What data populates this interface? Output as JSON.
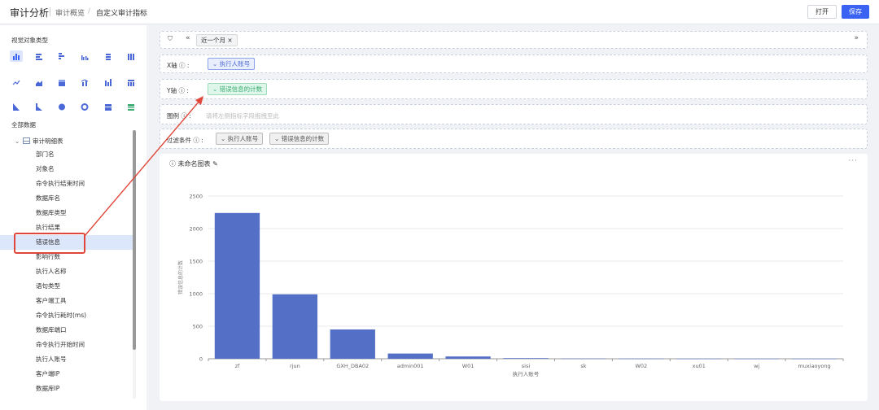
{
  "header": {
    "app_title": "审计分析",
    "breadcrumb": [
      "审计概览",
      "自定义审计指标"
    ],
    "open_label": "打开",
    "save_label": "保存"
  },
  "sidebar": {
    "visual_type_title": "视觉对象类型",
    "all_data_title": "全部数据",
    "table_name": "审计明细表",
    "fields": [
      "部门名",
      "对象名",
      "命令执行结束时间",
      "数据库名",
      "数据库类型",
      "执行结果",
      "错误信息",
      "影响行数",
      "执行人名称",
      "语句类型",
      "客户端工具",
      "命令执行耗时(ms)",
      "数据库端口",
      "命令执行开始时间",
      "执行人账号",
      "客户端IP",
      "数据库IP"
    ],
    "selected_field": "错误信息"
  },
  "filter_bar": {
    "chip": "近一个月"
  },
  "x_axis": {
    "label": "X轴",
    "field": "执行人账号"
  },
  "y_axis": {
    "label": "Y轴",
    "field": "错误信息的计数"
  },
  "legend": {
    "label": "图例",
    "placeholder": "请将左侧指标字段拖拽至此"
  },
  "filter": {
    "label": "过滤条件",
    "fields": [
      "执行人账号",
      "错误信息的计数"
    ]
  },
  "chart_panel": {
    "title": "未命名图表"
  },
  "chart_data": {
    "type": "bar",
    "categories": [
      "zf",
      "rjun",
      "GXH_DBA02",
      "admin001",
      "W01",
      "sisi",
      "sk",
      "W02",
      "xu01",
      "wj",
      "muxiaoyong"
    ],
    "values": [
      2240,
      990,
      450,
      80,
      35,
      10,
      3,
      2,
      1,
      1,
      1
    ],
    "xlabel": "执行人账号",
    "ylabel": "错误信息的计数",
    "ylim": [
      0,
      2500
    ],
    "yticks": [
      0,
      500,
      1000,
      1500,
      2000,
      2500
    ],
    "color": "#5470c6",
    "grid": true,
    "legend": "none"
  },
  "colors": {
    "accent": "#3a63f3",
    "annotation": "#e0473a",
    "bar": "#5470c6"
  }
}
